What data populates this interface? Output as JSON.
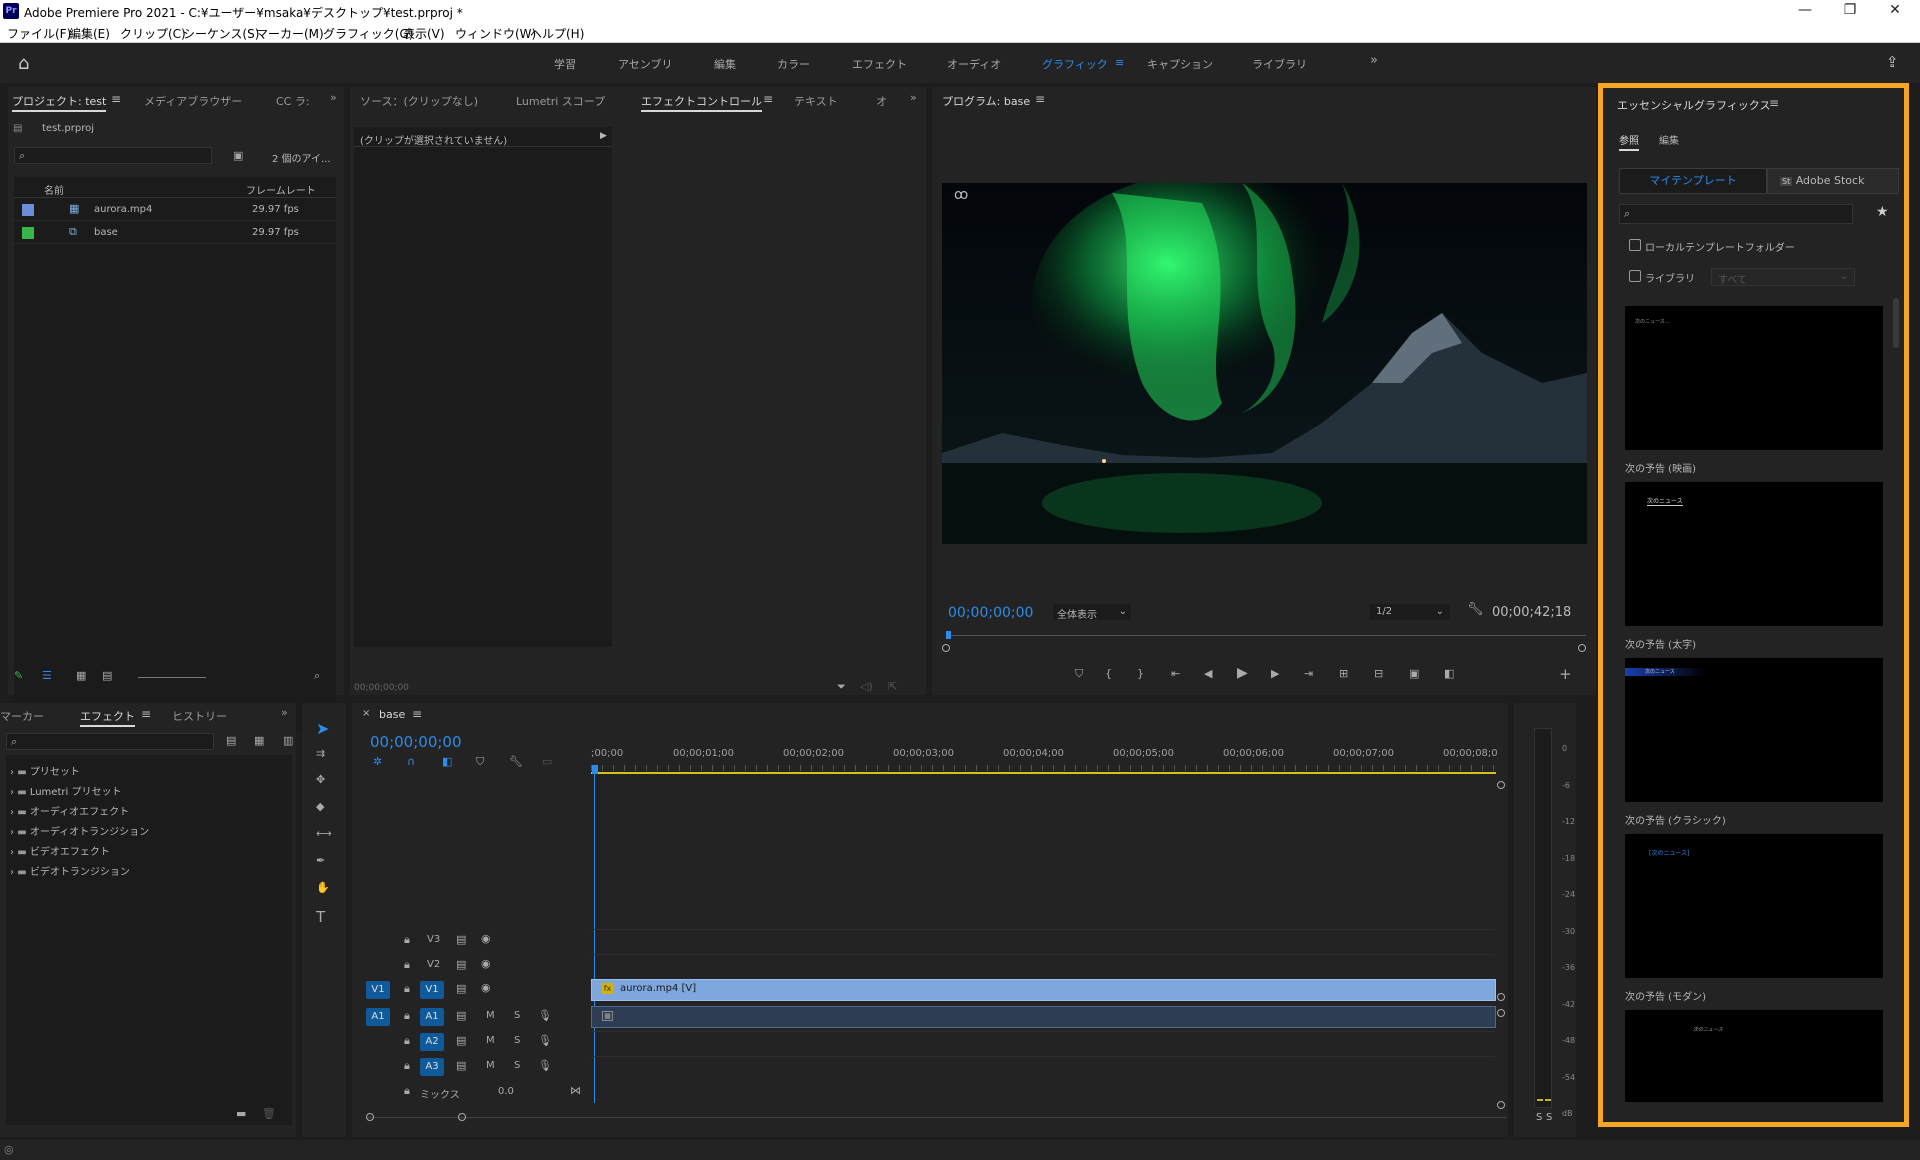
{
  "app": {
    "title": "Adobe Premiere Pro 2021 - C:¥ユーザー¥msaka¥デスクトップ¥test.prproj *",
    "logo": "Pr"
  },
  "menu": [
    "ファイル(F)",
    "編集(E)",
    "クリップ(C)",
    "シーケンス(S)",
    "マーカー(M)",
    "グラフィック(G)",
    "表示(V)",
    "ウィンドウ(W)",
    "ヘルプ(H)"
  ],
  "workspaces": [
    "学習",
    "アセンブリ",
    "編集",
    "カラー",
    "エフェクト",
    "オーディオ",
    "グラフィック",
    "キャプション",
    "ライブラリ"
  ],
  "project": {
    "tabs": [
      "プロジェクト: test",
      "メディアブラウザー",
      "CC ラ:"
    ],
    "file": "test.prproj",
    "count": "2 個のアイ...",
    "cols": [
      "名前",
      "フレームレート"
    ],
    "items": [
      {
        "name": "aurora.mp4",
        "fps": "29.97 fps",
        "color": "#6b8fd6"
      },
      {
        "name": "base",
        "fps": "29.97 fps",
        "color": "#3ab54a"
      }
    ]
  },
  "source": {
    "tabs": [
      "ソース：(クリップなし)",
      "Lumetri スコープ",
      "エフェクトコントロール",
      "テキスト",
      "オ"
    ],
    "noclip": "(クリップが選択されていません)",
    "tc": "00;00;00;00"
  },
  "program": {
    "title": "プログラム: base",
    "tc": "00;00;00;00",
    "fit": "全体表示",
    "res": "1/2",
    "dur": "00;00;42;18"
  },
  "effects": {
    "tabs": [
      "マーカー",
      "エフェクト",
      "ヒストリー"
    ],
    "tree": [
      "プリセット",
      "Lumetri プリセット",
      "オーディオエフェクト",
      "オーディオトランジション",
      "ビデオエフェクト",
      "ビデオトランジション"
    ]
  },
  "timeline": {
    "name": "base",
    "tc": "00;00;00;00",
    "ruler": [
      ";00;00",
      "00;00;01;00",
      "00;00;02;00",
      "00;00;03;00",
      "00;00;04;00",
      "00;00;05;00",
      "00;00;06;00",
      "00;00;07;00",
      "00;00;08;0"
    ],
    "vtracks": [
      "V3",
      "V2",
      "V1"
    ],
    "atracks": [
      "A1",
      "A2",
      "A3"
    ],
    "src_v": "V1",
    "src_a": "A1",
    "clip": "aurora.mp4 [V]",
    "mix": "ミックス",
    "mix_val": "0.0",
    "m": "M",
    "s": "S"
  },
  "meter": {
    "ticks": [
      "0",
      "-6",
      "-12",
      "-18",
      "-24",
      "-30",
      "-36",
      "-42",
      "-48",
      "-54",
      "dB"
    ],
    "ss": "S"
  },
  "eg": {
    "title": "エッセンシャルグラフィックス",
    "tabs": [
      "参照",
      "編集"
    ],
    "my": "マイテンプレート",
    "stock": "Adobe Stock",
    "local": "ローカルテンプレートフォルダー",
    "lib": "ライブラリ",
    "lib_val": "すべて",
    "templates": [
      {
        "name": "次の予告 (映画)",
        "text": "次のニュース..."
      },
      {
        "name": "次の予告 (太字)",
        "text": "次のニュース"
      },
      {
        "name": "次の予告 (クラシック)",
        "text": "次のニュース"
      },
      {
        "name": "次の予告 (モダン)",
        "text": "[次のニュース]"
      },
      {
        "name": "",
        "text": "次のニュース"
      }
    ]
  },
  "colors": {
    "accent": "#2d8ceb",
    "highlight": "#f5a623"
  }
}
